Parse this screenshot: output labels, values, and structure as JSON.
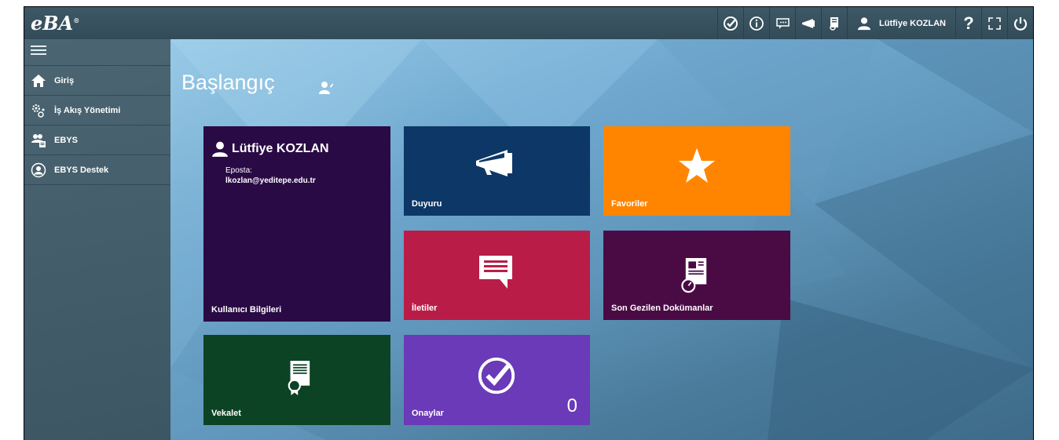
{
  "app": {
    "logo": "eBA",
    "logo_mark": "®"
  },
  "topbar": {
    "user_name": "Lütfiye KOZLAN",
    "help_label": "?",
    "icons": [
      "check-circle-icon",
      "info-icon",
      "chat-icon",
      "megaphone-icon",
      "document-icon",
      "user-icon",
      "fullscreen-icon",
      "power-icon"
    ]
  },
  "sidebar": {
    "items": [
      {
        "label": "Giriş",
        "icon": "home-icon"
      },
      {
        "label": "İş Akış Yönetimi",
        "icon": "workflow-icon"
      },
      {
        "label": "EBYS",
        "icon": "users-docs-icon"
      },
      {
        "label": "EBYS Destek",
        "icon": "support-icon"
      }
    ]
  },
  "main": {
    "title": "Başlangıç",
    "tiles": {
      "user": {
        "name": "Lütfiye KOZLAN",
        "email_label": "Eposta:",
        "email": "lkozlan@yeditepe.edu.tr",
        "label": "Kullanıcı Bilgileri",
        "color": "#2a0a45"
      },
      "duyuru": {
        "label": "Duyuru",
        "color": "#0c3766"
      },
      "favoriler": {
        "label": "Favoriler",
        "color": "#ff8500"
      },
      "iletiler": {
        "label": "İletiler",
        "color": "#b91d47"
      },
      "son": {
        "label": "Son Gezilen Dokümanlar",
        "color": "#4a0b45"
      },
      "vekalet": {
        "label": "Vekalet",
        "color": "#0c4324"
      },
      "onaylar": {
        "label": "Onaylar",
        "count": "0",
        "color": "#6a3ab8"
      }
    }
  }
}
